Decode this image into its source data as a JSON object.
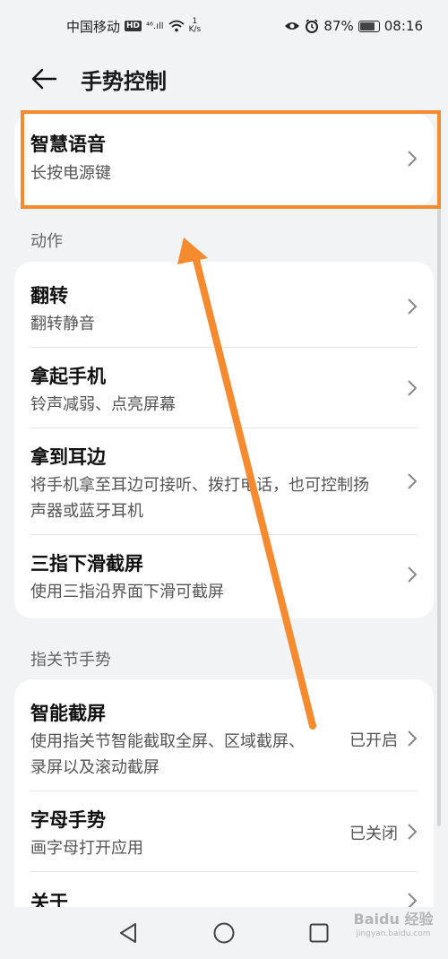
{
  "status_bar": {
    "carrier": "中国移动",
    "hd": "HD",
    "network": "⁴⁶.ıll",
    "speed_value": "1",
    "speed_unit": "K/s",
    "battery": "87%",
    "time": "08:16"
  },
  "header": {
    "title": "手势控制"
  },
  "top_item": {
    "title": "智慧语音",
    "subtitle": "长按电源键"
  },
  "section_actions": {
    "label": "动作",
    "items": [
      {
        "title": "翻转",
        "subtitle": "翻转静音"
      },
      {
        "title": "拿起手机",
        "subtitle": "铃声减弱、点亮屏幕"
      },
      {
        "title": "拿到耳边",
        "subtitle": "将手机拿至耳边可接听、拨打电话，也可控制扬声器或蓝牙耳机"
      },
      {
        "title": "三指下滑截屏",
        "subtitle": "使用三指沿界面下滑可截屏"
      }
    ]
  },
  "section_knuckle": {
    "label": "指关节手势",
    "items": [
      {
        "title": "智能截屏",
        "subtitle": "使用指关节智能截取全屏、区域截屏、录屏以及滚动截屏",
        "status": "已开启"
      },
      {
        "title": "字母手势",
        "subtitle": "画字母打开应用",
        "status": "已关闭"
      },
      {
        "title": "关于"
      }
    ]
  },
  "watermark": {
    "text": "Baidu 经验",
    "sub": "jingyan.baidu.com"
  },
  "colors": {
    "highlight": "#f58b2e",
    "background": "#f1f3f5",
    "card": "#ffffff"
  }
}
